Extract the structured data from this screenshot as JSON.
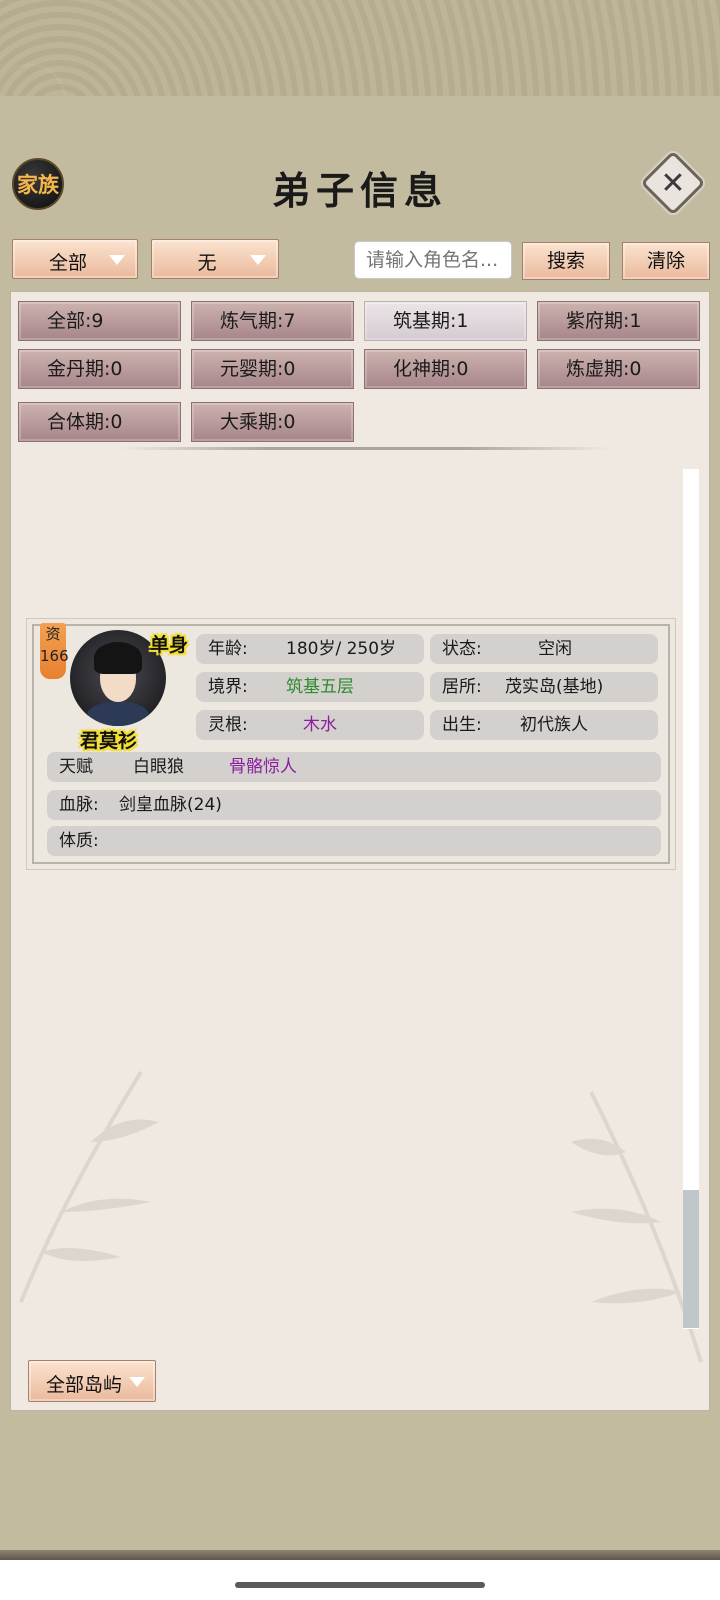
{
  "header": {
    "title": "弟子信息",
    "clan_button": "家族"
  },
  "filters": {
    "category": "全部",
    "secondary": "无",
    "search_placeholder": "请输入角色名...",
    "search_button": "搜索",
    "clear_button": "清除"
  },
  "realms": [
    {
      "label": "全部:9"
    },
    {
      "label": "炼气期:7"
    },
    {
      "label": "筑基期:1"
    },
    {
      "label": "紫府期:1"
    },
    {
      "label": "金丹期:0"
    },
    {
      "label": "元婴期:0"
    },
    {
      "label": "化神期:0"
    },
    {
      "label": "炼虚期:0"
    },
    {
      "label": "合体期:0"
    },
    {
      "label": "大乘期:0"
    }
  ],
  "character": {
    "aptitude_label": "资",
    "aptitude_value": "166",
    "marital": "单身",
    "name": "君莫衫",
    "age_label": "年龄:",
    "age_value": "180岁/ 250岁",
    "status_label": "状态:",
    "status_value": "空闲",
    "realm_label": "境界:",
    "realm_value": "筑基五层",
    "residence_label": "居所:",
    "residence_value": "茂实岛(基地)",
    "root_label": "灵根:",
    "root_value": "木水",
    "birth_label": "出生:",
    "birth_value": "初代族人",
    "talent_label": "天赋",
    "talent_1": "白眼狼",
    "talent_2": "骨骼惊人",
    "bloodline_label": "血脉:",
    "bloodline_value": "剑皇血脉(24)",
    "physique_label": "体质:"
  },
  "footer": {
    "island_filter": "全部岛屿"
  },
  "colors": {
    "realm_value": "#2e8b2e",
    "root_value": "#8a1fa0",
    "talent_2": "#8a1fa0",
    "name_outline": "#f3df2d"
  }
}
